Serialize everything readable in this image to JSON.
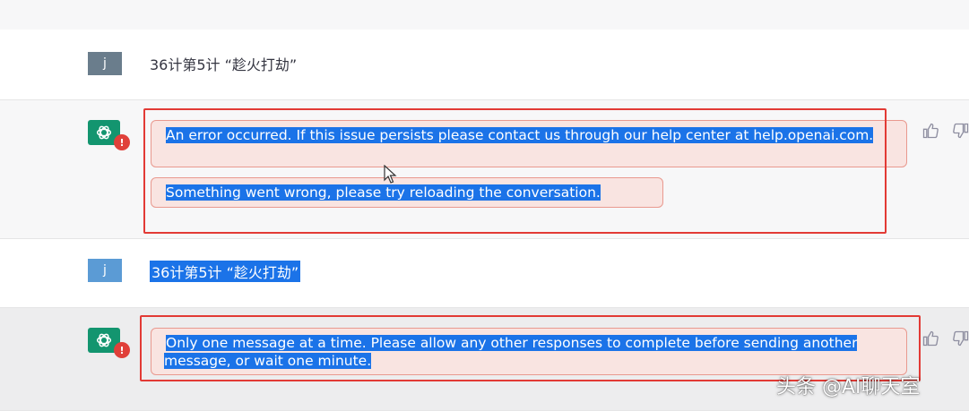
{
  "conversation": [
    {
      "role": "user",
      "avatar": "j",
      "text": "36计第5计 “趁火打劫”",
      "selected": false
    },
    {
      "role": "assistant",
      "avatar": "chatgpt-logo-icon",
      "status": "error",
      "messages": [
        "An error occurred. If this issue persists please contact us through our help center at help.openai.com.",
        "Something went wrong, please try reloading the conversation."
      ]
    },
    {
      "role": "user",
      "avatar": "j",
      "text": "36计第5计 “趁火打劫”",
      "selected": true
    },
    {
      "role": "assistant",
      "avatar": "chatgpt-logo-icon",
      "status": "error",
      "messages": [
        "Only one message at a time. Please allow any other responses to complete before sending another message, or wait one minute."
      ]
    }
  ],
  "feedback_icons": [
    "thumbs-up-icon",
    "thumbs-down-icon"
  ],
  "watermark": "头条 @AI聊天室",
  "colors": {
    "error_bg": "#f9e4e1",
    "error_border": "#e9998f",
    "highlight_frame": "#e23a35",
    "selection": "#1b73e8",
    "assistant_avatar": "#13956f",
    "user_avatar": "#6a7d8c"
  }
}
